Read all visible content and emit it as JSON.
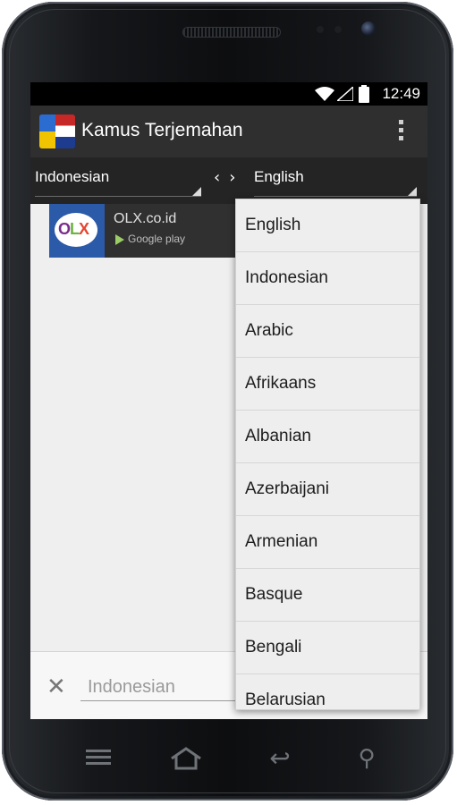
{
  "status_bar": {
    "time": "12:49"
  },
  "app_bar": {
    "title": "Kamus Terjemahan"
  },
  "language_bar": {
    "source_language": "Indonesian",
    "target_language": "English"
  },
  "ad": {
    "title": "OLX.co.id",
    "store": "Google play",
    "logo_text": "OLX"
  },
  "input": {
    "placeholder": "Indonesian"
  },
  "dropdown": {
    "items": [
      "English",
      "Indonesian",
      "Arabic",
      "Afrikaans",
      "Albanian",
      "Azerbaijani",
      "Armenian",
      "Basque",
      "Bengali",
      "Belarusian"
    ]
  },
  "colors": {
    "action_bar": "#2f2f2f",
    "language_bar": "#242424",
    "screen_background": "#efefef",
    "dropdown_background": "#eeeeee"
  }
}
